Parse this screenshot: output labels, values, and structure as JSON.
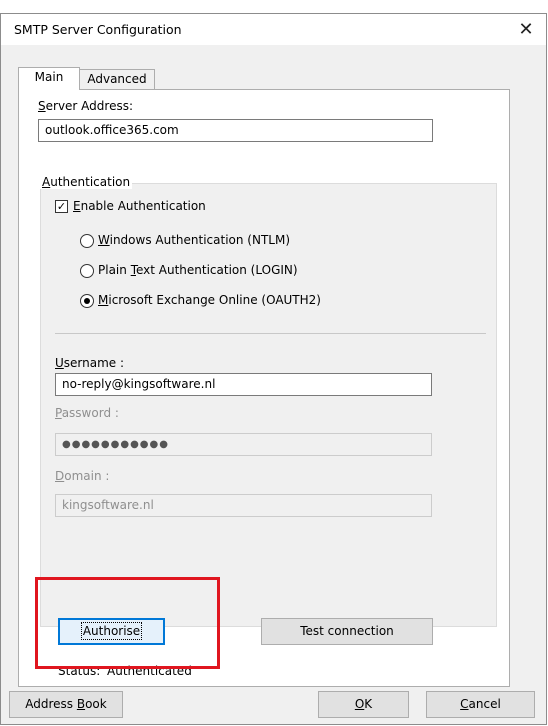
{
  "window": {
    "title": "SMTP Server Configuration",
    "close_glyph": "✕"
  },
  "tabs": [
    {
      "label": "Main",
      "active": true
    },
    {
      "label": "Advanced",
      "active": false
    }
  ],
  "server_address": {
    "label_prefix": "S",
    "label_rest": "erver Address:",
    "value": "outlook.office365.com"
  },
  "authentication": {
    "group_prefix": "A",
    "group_rest": "uthentication",
    "enable_prefix": "E",
    "enable_rest": "nable Authentication",
    "enable_checked": true,
    "check_glyph": "✓",
    "options": [
      {
        "pre": "",
        "u": "W",
        "post": "indows Authentication (NTLM)",
        "selected": false
      },
      {
        "pre": "Plain ",
        "u": "T",
        "post": "ext Authentication (LOGIN)",
        "selected": false
      },
      {
        "pre": "",
        "u": "M",
        "post": "icrosoft Exchange Online (OAUTH2)",
        "selected": true
      }
    ],
    "username_prefix": "U",
    "username_rest": "sername :",
    "username_value": "no-reply@kingsoftware.nl",
    "password_prefix": "P",
    "password_rest": "assword :",
    "password_value": "●●●●●●●●●●●",
    "domain_prefix": "D",
    "domain_rest": "omain :",
    "domain_value": "kingsoftware.nl"
  },
  "buttons": {
    "authorise": "Authorise",
    "test_connection": "Test connection",
    "address_book_pre": "Address ",
    "address_book_u": "B",
    "address_book_post": "ook",
    "ok_u": "O",
    "ok_post": "K",
    "cancel_u": "C",
    "cancel_post": "ancel"
  },
  "status": {
    "label": "Status:",
    "value": "Authenticated"
  },
  "colors": {
    "highlight": "#e0161f",
    "focus": "#0078d7"
  }
}
